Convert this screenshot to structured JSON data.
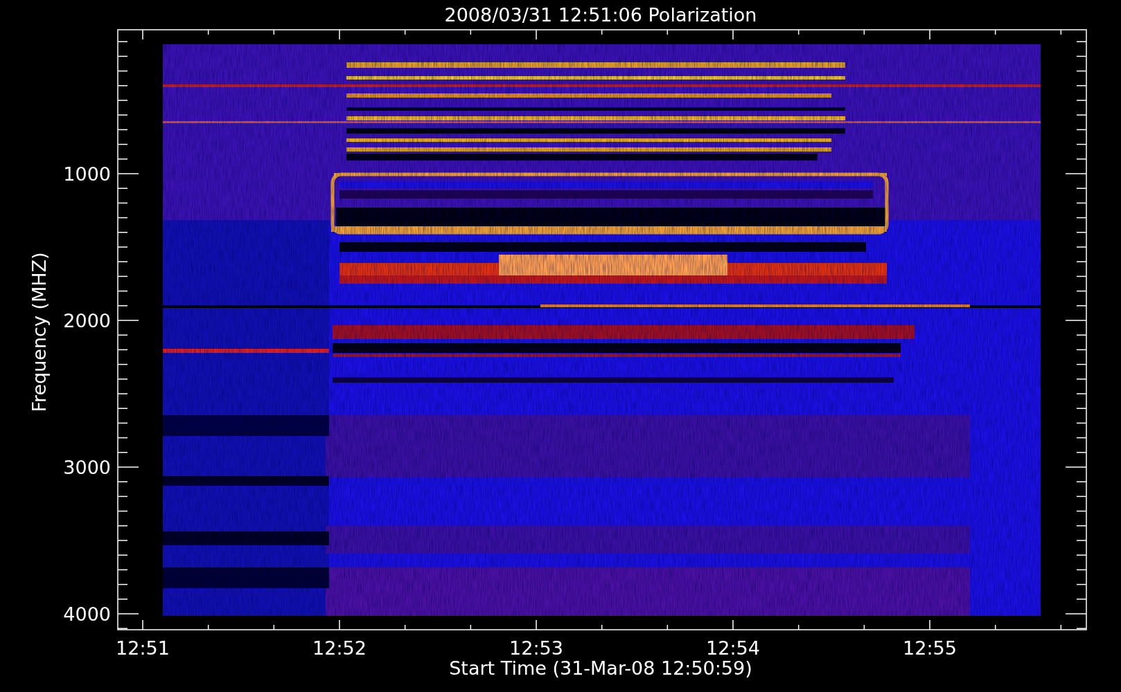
{
  "title": "2008/03/31 12:51:06 Polarization",
  "x_axis": {
    "label": "Start Time (31-Mar-08 12:50:59)",
    "ticks": [
      "12:51",
      "12:52",
      "12:53",
      "12:54",
      "12:55"
    ]
  },
  "y_axis": {
    "label": "Frequency (MHZ)",
    "ticks": [
      "1000",
      "2000",
      "3000",
      "4000"
    ]
  }
}
